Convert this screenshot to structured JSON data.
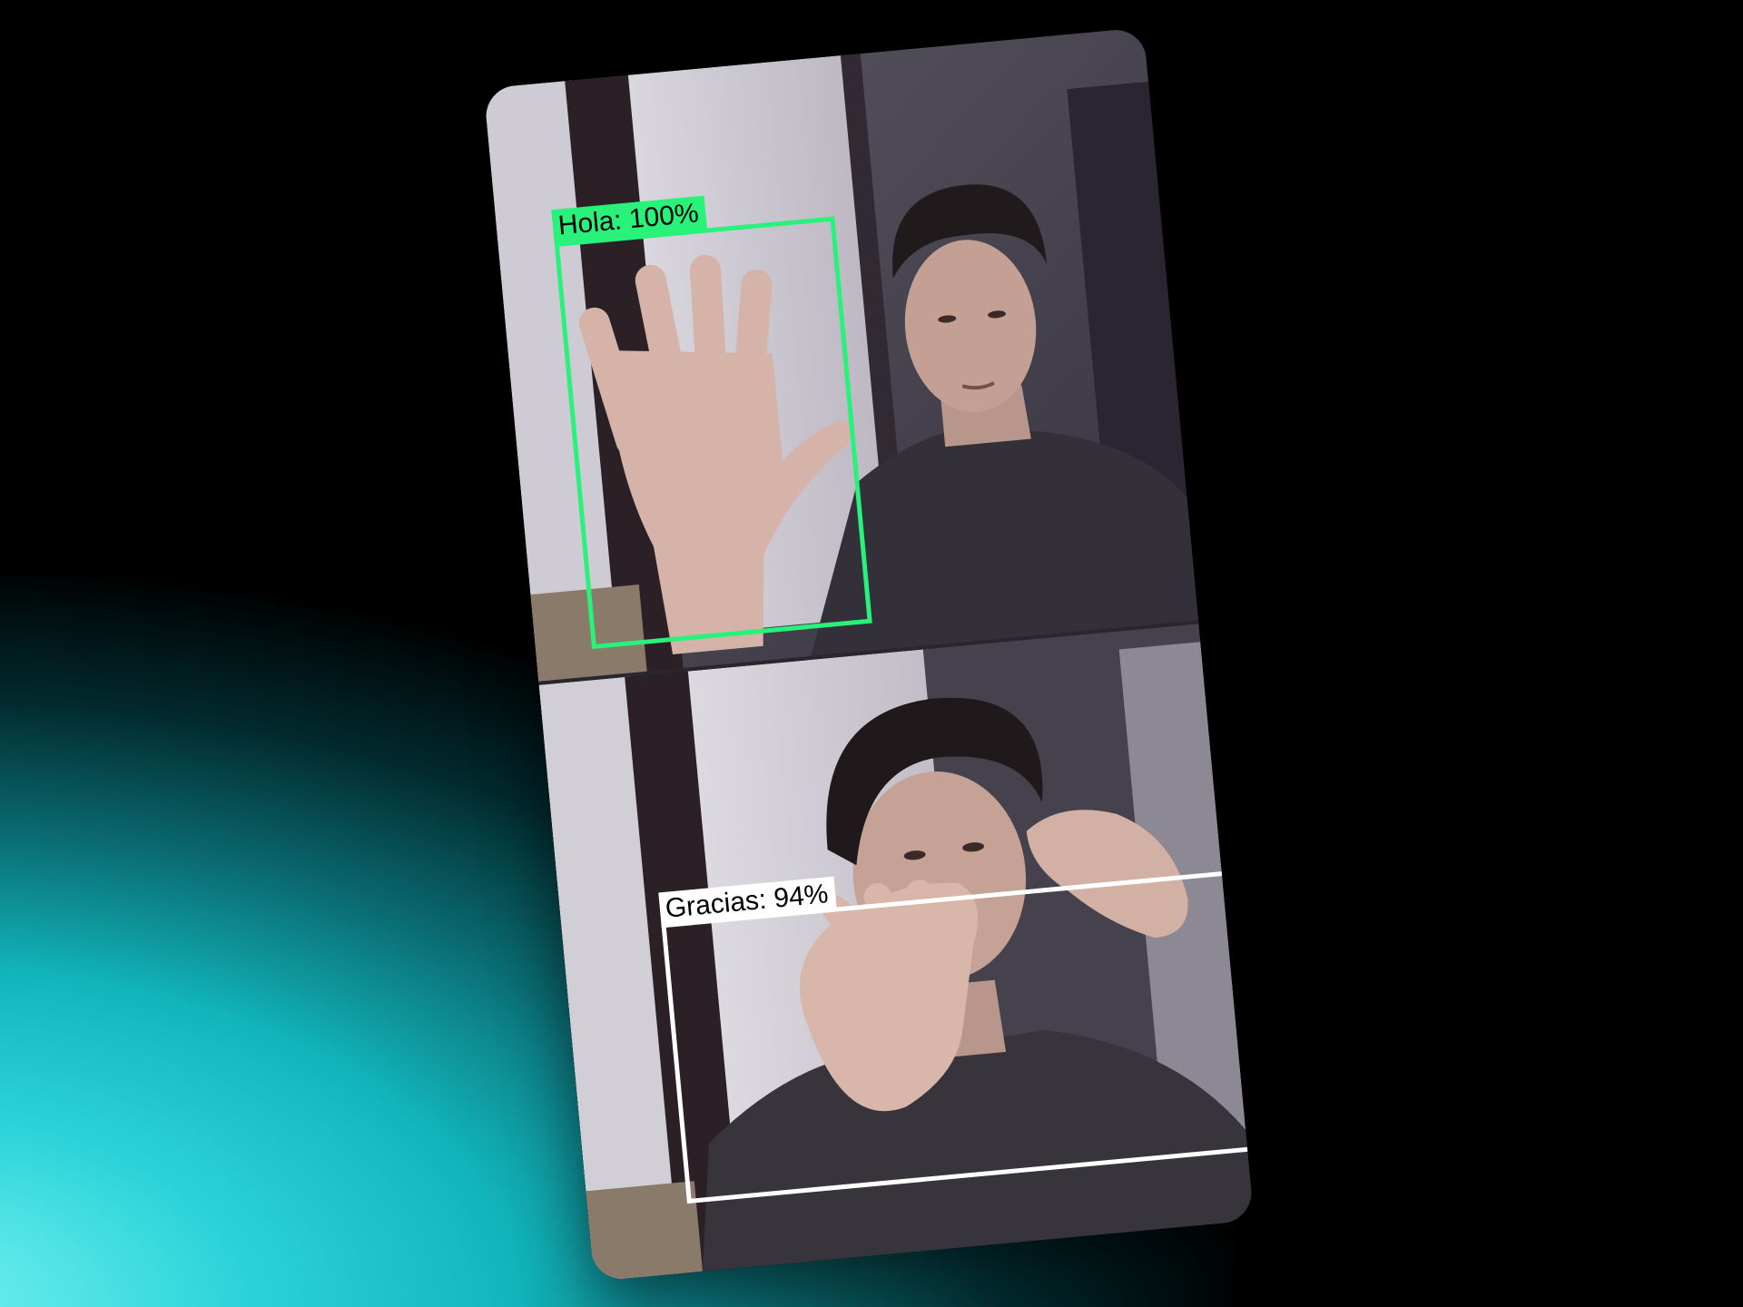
{
  "scene": {
    "background_gradient": [
      "#000000",
      "#12b4bb",
      "#7af4f6"
    ],
    "card_border_color": "#ffffff"
  },
  "top_panel": {
    "detection": {
      "label": "Hola: 100%",
      "box_color": "#28f27a"
    }
  },
  "bottom_panel": {
    "detection": {
      "label": "Gracias: 94%",
      "box_color": "#ffffff"
    }
  }
}
